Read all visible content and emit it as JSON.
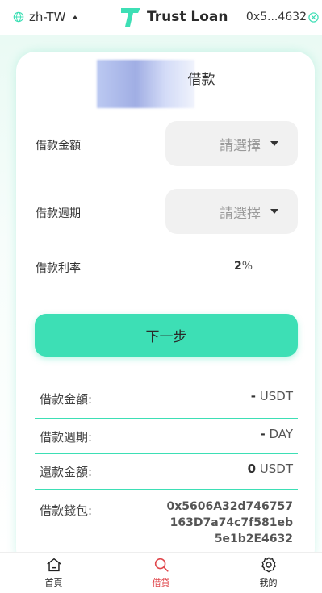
{
  "header": {
    "language": "zh-TW",
    "brand": "Trust Loan",
    "wallet_short": "0x5...4632"
  },
  "loan_form": {
    "title": "借款",
    "amount_label": "借款金額",
    "amount_placeholder": "請選擇",
    "period_label": "借款週期",
    "period_placeholder": "請選擇",
    "rate_label": "借款利率",
    "rate_value": "2",
    "rate_unit": "%",
    "next_button": "下一步"
  },
  "summary": {
    "rows": [
      {
        "label": "借款金額:",
        "value": "-",
        "unit": "USDT"
      },
      {
        "label": "借款週期:",
        "value": "-",
        "unit": "DAY"
      },
      {
        "label": "還款金額:",
        "value": "0",
        "unit": "USDT"
      }
    ],
    "wallet_label": "借款錢包:",
    "wallet_lines": [
      "0x5606A32d746757",
      "163D7a74c7f581eb",
      "5e1b2E4632"
    ]
  },
  "nav": [
    {
      "label": "首頁",
      "icon": "home-icon"
    },
    {
      "label": "借貸",
      "icon": "search-icon"
    },
    {
      "label": "我的",
      "icon": "gear-icon"
    }
  ],
  "colors": {
    "accent": "#3ddfb5",
    "active_nav": "#e0464b"
  }
}
